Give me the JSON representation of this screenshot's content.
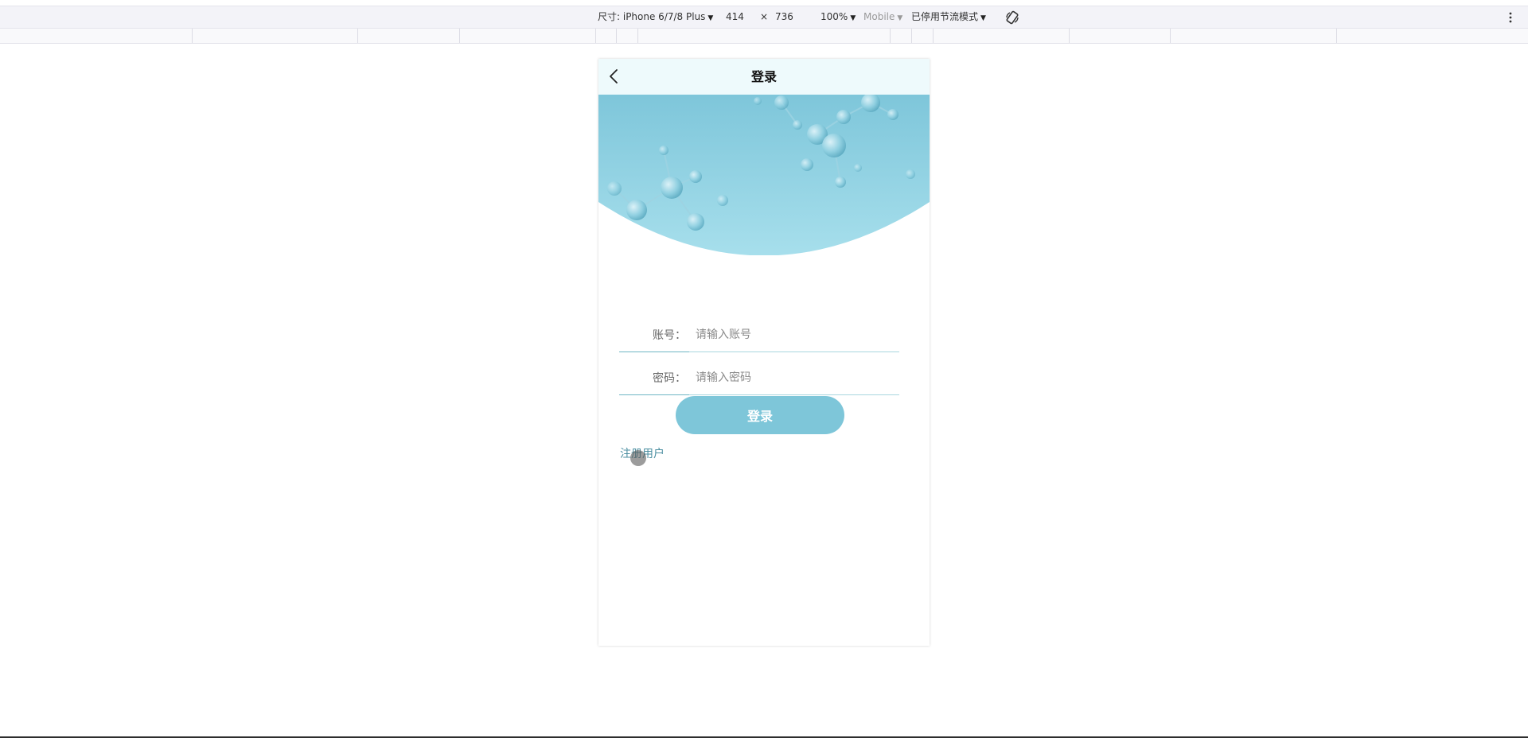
{
  "devtools": {
    "device_label": "尺寸: iPhone 6/7/8 Plus",
    "width": "414",
    "times": "×",
    "height": "736",
    "zoom": "100%",
    "mode": "Mobile",
    "throttle": "已停用节流模式"
  },
  "app": {
    "title": "登录",
    "account_label": "账号：",
    "account_placeholder": "请输入账号",
    "password_label": "密码：",
    "password_placeholder": "请输入密码",
    "login_button": "登录",
    "register_link": "注册用户"
  },
  "colors": {
    "accent": "#7ec6d9",
    "navbar_bg": "#eefafc",
    "link": "#4c8fa1"
  }
}
